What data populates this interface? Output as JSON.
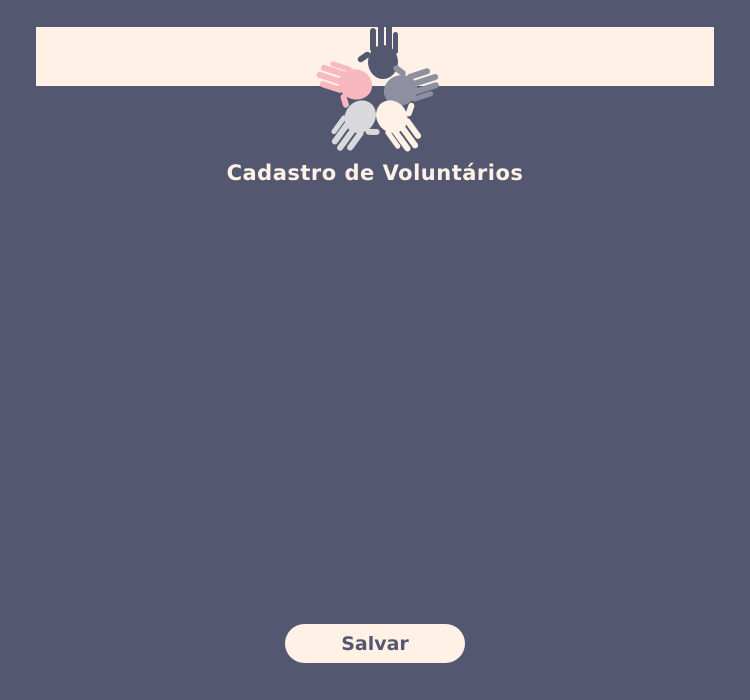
{
  "header": {
    "title": "Cadastro de Voluntários",
    "logo_icon": "hands-circle-icon"
  },
  "form": {
    "save_label": "Salvar"
  },
  "colors": {
    "background": "#545770",
    "band": "#fff1e6",
    "hand_pink": "#f7b9bd",
    "hand_dark": "#545770",
    "hand_grey": "#8e8fa1",
    "hand_light": "#d9d9dd",
    "hand_cream": "#fff1e6"
  }
}
